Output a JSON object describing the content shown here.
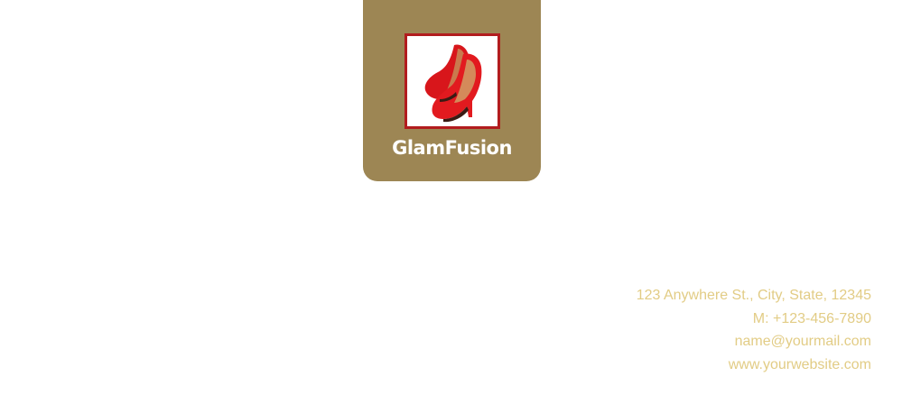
{
  "brand": {
    "name": "GlamFusion"
  },
  "contact": {
    "address": "123 Anywhere St., City, State, 12345",
    "phone": "M: +123-456-7890",
    "email": "name@yourmail.com",
    "website": "www.yourwebsite.com"
  },
  "colors": {
    "tab_background": "#9d8654",
    "image_border": "#b21c1e",
    "contact_text": "#e2cc85",
    "brand_text": "#ffffff"
  },
  "icons": {
    "logo_image": "red-high-heel-shoes-image"
  }
}
